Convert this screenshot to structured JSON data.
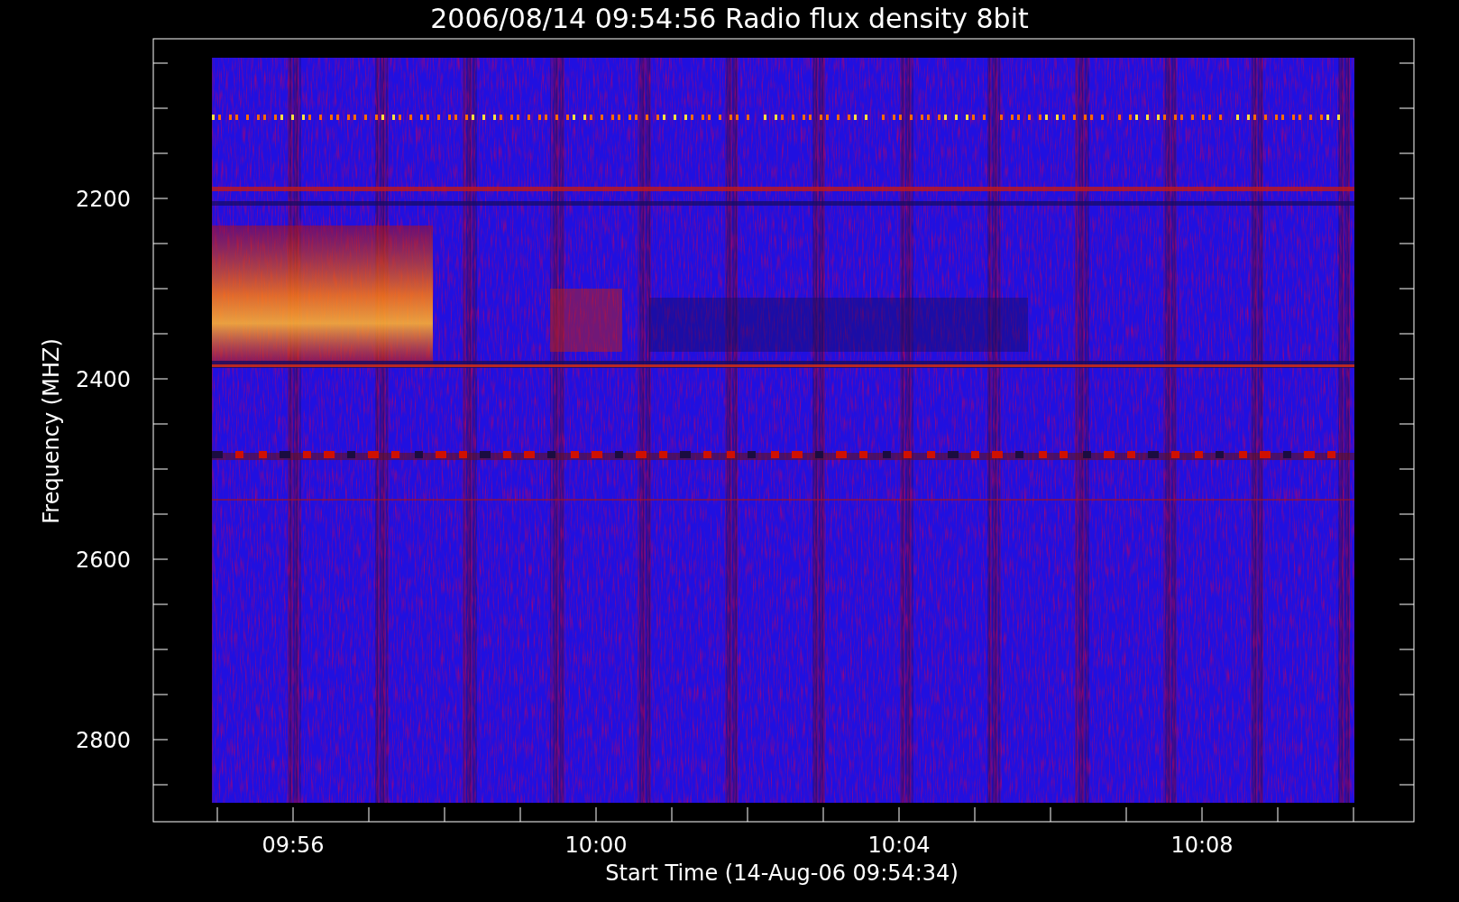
{
  "title": "2006/08/14 09:54:56 Radio flux density 8bit",
  "plot": {
    "xlabel": "Start Time (14-Aug-06 09:54:34)",
    "ylabel": "Frequency (MHZ)",
    "yticks": [
      "2200",
      "2400",
      "2600",
      "2800"
    ],
    "xticks": [
      "09:56",
      "10:00",
      "10:04",
      "10:08"
    ]
  }
}
